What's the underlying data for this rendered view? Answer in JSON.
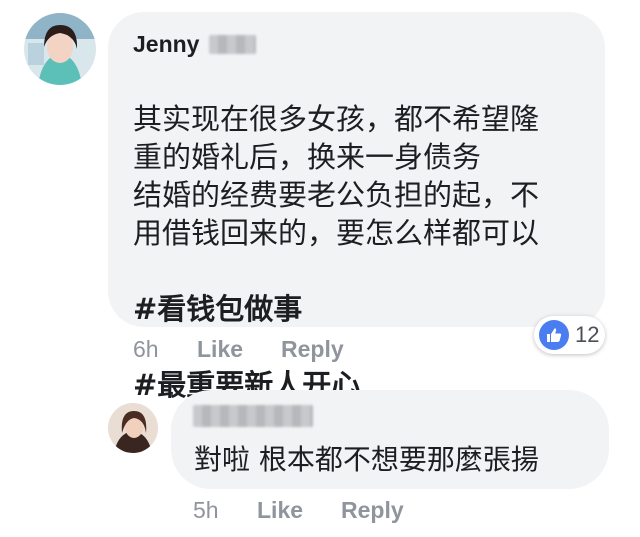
{
  "comment": {
    "author": "Jenny",
    "text": "其实现在很多女孩，都不希望隆\n重的婚礼后，换来一身债务\n结婚的经费要老公负担的起，不\n用借钱回来的，要怎么样都可以",
    "hashtags": [
      "#看钱包做事",
      "#最重要新人开心"
    ],
    "time": "6h",
    "like_label": "Like",
    "reply_label": "Reply",
    "reaction": {
      "icon": "thumbs-up-icon",
      "count": "12"
    }
  },
  "reply": {
    "text": "對啦 根本都不想要那麼張揚",
    "time": "5h",
    "like_label": "Like",
    "reply_label": "Reply"
  },
  "colors": {
    "bubble": "#f2f3f5",
    "text": "#1c1e21",
    "meta": "#90949c",
    "like_blue": "#4a7df0"
  }
}
